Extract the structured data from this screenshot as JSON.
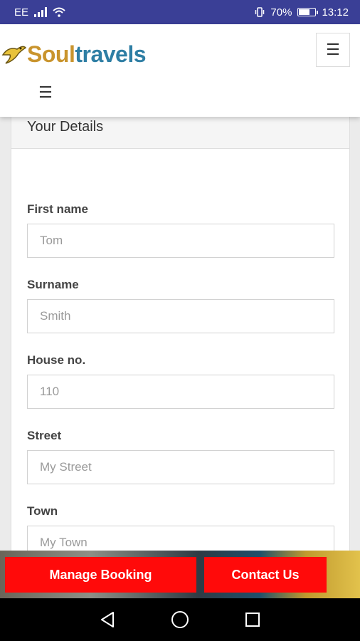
{
  "status_bar": {
    "carrier": "EE",
    "battery_percent": "70%",
    "battery_level": 0.7,
    "time": "13:12"
  },
  "header": {
    "logo_part1": "Soul",
    "logo_part2": "travels",
    "menu_icon": "☰"
  },
  "form": {
    "title": "Your Details",
    "fields": [
      {
        "label": "First name",
        "placeholder": "Tom"
      },
      {
        "label": "Surname",
        "placeholder": "Smith"
      },
      {
        "label": "House no.",
        "placeholder": "110"
      },
      {
        "label": "Street",
        "placeholder": "My Street"
      },
      {
        "label": "Town",
        "placeholder": "My Town"
      }
    ]
  },
  "actions": {
    "manage_booking": "Manage Booking",
    "contact_us": "Contact Us"
  },
  "colors": {
    "status_bar": "#3a3f96",
    "button_red": "#ff0a0a",
    "logo_gold": "#c9942d",
    "logo_blue": "#2e7ea4"
  }
}
